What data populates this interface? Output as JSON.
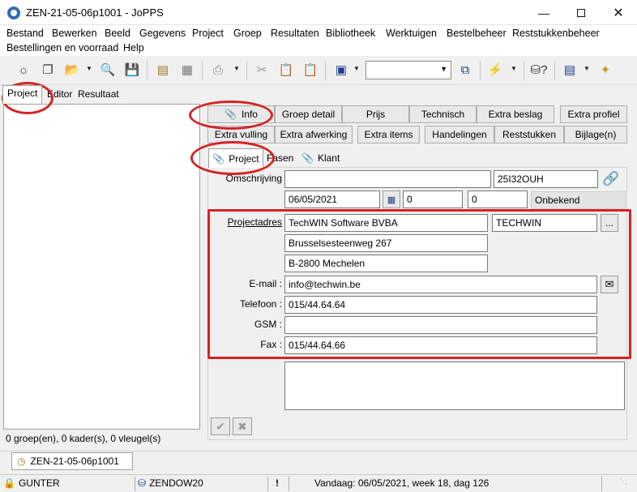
{
  "window": {
    "title": "ZEN-21-05-06p1001 - JoPPS"
  },
  "menu": [
    "Bestand",
    "Bewerken",
    "Beeld",
    "Gegevens",
    "Project",
    "Groep",
    "Resultaten",
    "Bibliotheek",
    "Werktuigen",
    "Bestelbeheer",
    "Reststukkenbeheer",
    "Bestellingen en voorraad",
    "Help"
  ],
  "left_tabs": [
    "Project",
    "Editor",
    "Resultaat"
  ],
  "left_status": "0 groep(en), 0 kader(s), 0 vleugel(s)",
  "button_row1": [
    "Info",
    "Groep detail",
    "Prijs",
    "Technisch",
    "Extra beslag",
    "Extra profiel"
  ],
  "button_row2": [
    "Extra vulling",
    "Extra afwerking",
    "Extra items",
    "Handelingen",
    "Reststukken",
    "Bijlage(n)"
  ],
  "sub_tabs": [
    "Project",
    "Fasen",
    "Klant"
  ],
  "form": {
    "omschrijving_label": "Omschrijving",
    "omschrijving_value": "",
    "code_value": "25I32OUH",
    "date_value": "06/05/2021",
    "num1_value": "0",
    "num2_value": "0",
    "status_value": "Onbekend",
    "projectadres_label": "Projectadres",
    "address_line1": "TechWIN Software BVBA",
    "address_line2": "Brusselsesteenweg 267",
    "address_line3": "B-2800 Mechelen",
    "short_name": "TECHWIN",
    "ellipsis_label": "...",
    "email_label": "E-mail :",
    "email_value": "info@techwin.be",
    "telefoon_label": "Telefoon :",
    "telefoon_value": "015/44.64.64",
    "gsm_label": "GSM :",
    "gsm_value": "",
    "fax_label": "Fax :",
    "fax_value": "015/44.64.66"
  },
  "doc_tab": "ZEN-21-05-06p1001",
  "statusbar": {
    "user": "GUNTER",
    "db": "ZENDOW20",
    "alert": "!",
    "today": "Vandaag: 06/05/2021, week 18, dag 126"
  },
  "colors": {
    "highlight": "#d42424",
    "app_icon": "#2a6fb5"
  }
}
